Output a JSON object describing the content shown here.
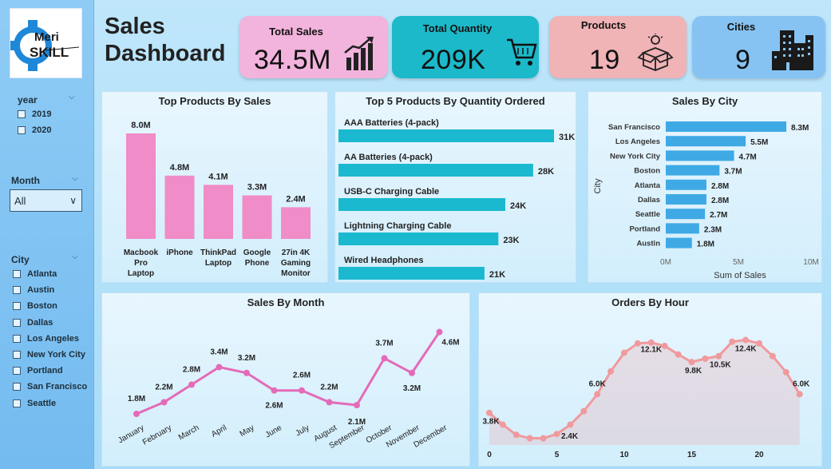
{
  "logo": {
    "line1": "Meri",
    "line2": "SKILL"
  },
  "title": {
    "line1": "Sales",
    "line2": "Dashboard"
  },
  "filters": {
    "year": {
      "label": "year",
      "options": [
        "2019",
        "2020"
      ]
    },
    "month": {
      "label": "Month",
      "selected": "All"
    },
    "city": {
      "label": "City",
      "options": [
        "Atlanta",
        "Austin",
        "Boston",
        "Dallas",
        "Los Angeles",
        "New York City",
        "Portland",
        "San Francisco",
        "Seattle"
      ]
    }
  },
  "kpis": [
    {
      "label": "Total Sales",
      "value": "34.5M",
      "color": "#f2b3dc",
      "icon": "bar-growth-icon"
    },
    {
      "label": "Total Quantity",
      "value": "209K",
      "color": "#1bb9c9",
      "icon": "shopping-cart-icon"
    },
    {
      "label": "Products",
      "value": "19",
      "color": "#f0b3b6",
      "icon": "idea-box-icon"
    },
    {
      "label": "Cities",
      "value": "9",
      "color": "#86c3f3",
      "icon": "city-buildings-icon"
    }
  ],
  "chart_data": [
    {
      "type": "bar",
      "title": "Top Products By Sales",
      "categories": [
        [
          "Macbook",
          "Pro",
          "Laptop"
        ],
        [
          "iPhone"
        ],
        [
          "ThinkPad",
          "Laptop"
        ],
        [
          "Google",
          "Phone"
        ],
        [
          "27in 4K",
          "Gaming",
          "Monitor"
        ]
      ],
      "values": [
        8.0,
        4.8,
        4.1,
        3.3,
        2.4
      ],
      "labels": [
        "8.0M",
        "4.8M",
        "4.1M",
        "3.3M",
        "2.4M"
      ],
      "color": "#f08cc8"
    },
    {
      "type": "bar",
      "orientation": "horizontal",
      "title": "Top 5 Products By Quantity Ordered",
      "categories": [
        "AAA Batteries (4-pack)",
        "AA Batteries (4-pack)",
        "USB-C Charging Cable",
        "Lightning Charging Cable",
        "Wired Headphones"
      ],
      "values": [
        31,
        28,
        24,
        23,
        21
      ],
      "labels": [
        "31K",
        "28K",
        "24K",
        "23K",
        "21K"
      ],
      "color": "#1bb9cf"
    },
    {
      "type": "bar",
      "orientation": "horizontal",
      "title": "Sales By City",
      "ylabel": "City",
      "xlabel": "Sum of Sales",
      "categories": [
        "San Francisco",
        "Los Angeles",
        "New York City",
        "Boston",
        "Atlanta",
        "Dallas",
        "Seattle",
        "Portland",
        "Austin"
      ],
      "values": [
        8.3,
        5.5,
        4.7,
        3.7,
        2.8,
        2.8,
        2.7,
        2.3,
        1.8
      ],
      "labels": [
        "8.3M",
        "5.5M",
        "4.7M",
        "3.7M",
        "2.8M",
        "2.8M",
        "2.7M",
        "2.3M",
        "1.8M"
      ],
      "xticks": [
        "0M",
        "5M",
        "10M"
      ],
      "xlim": [
        0,
        10
      ],
      "color": "#3fa9e6"
    },
    {
      "type": "line",
      "title": "Sales By Month",
      "categories": [
        "January",
        "February",
        "March",
        "April",
        "May",
        "June",
        "July",
        "August",
        "September",
        "October",
        "November",
        "December"
      ],
      "values": [
        1.8,
        2.2,
        2.8,
        3.4,
        3.2,
        2.6,
        2.6,
        2.2,
        2.1,
        3.7,
        3.2,
        4.6
      ],
      "labels": [
        "1.8M",
        "2.2M",
        "2.8M",
        "3.4M",
        "3.2M",
        "2.6M",
        "2.6M",
        "2.2M",
        "2.1M",
        "3.7M",
        "3.2M",
        "4.6M"
      ],
      "color": "#e36bb8"
    },
    {
      "type": "area",
      "title": "Orders By Hour",
      "x": [
        0,
        1,
        2,
        3,
        4,
        5,
        6,
        7,
        8,
        9,
        10,
        11,
        12,
        13,
        14,
        15,
        16,
        17,
        18,
        19,
        20,
        21,
        22,
        23
      ],
      "values": [
        3.8,
        2.4,
        1.2,
        0.8,
        0.8,
        1.3,
        2.4,
        4.0,
        6.0,
        8.7,
        10.9,
        12.0,
        12.1,
        11.7,
        10.7,
        9.8,
        10.2,
        10.5,
        12.2,
        12.4,
        12.0,
        10.5,
        8.6,
        6.0
      ],
      "point_labels": [
        {
          "x": 0,
          "label": "3.8K"
        },
        {
          "x": 5,
          "label": "2.4K"
        },
        {
          "x": 8,
          "label": "6.0K"
        },
        {
          "x": 12,
          "label": "12.1K"
        },
        {
          "x": 15,
          "label": "9.8K"
        },
        {
          "x": 17,
          "label": "10.5K"
        },
        {
          "x": 19,
          "label": "12.4K"
        },
        {
          "x": 23,
          "label": "6.0K"
        }
      ],
      "xticks": [
        0,
        5,
        10,
        15,
        20
      ],
      "color": "#f09a9e"
    }
  ]
}
